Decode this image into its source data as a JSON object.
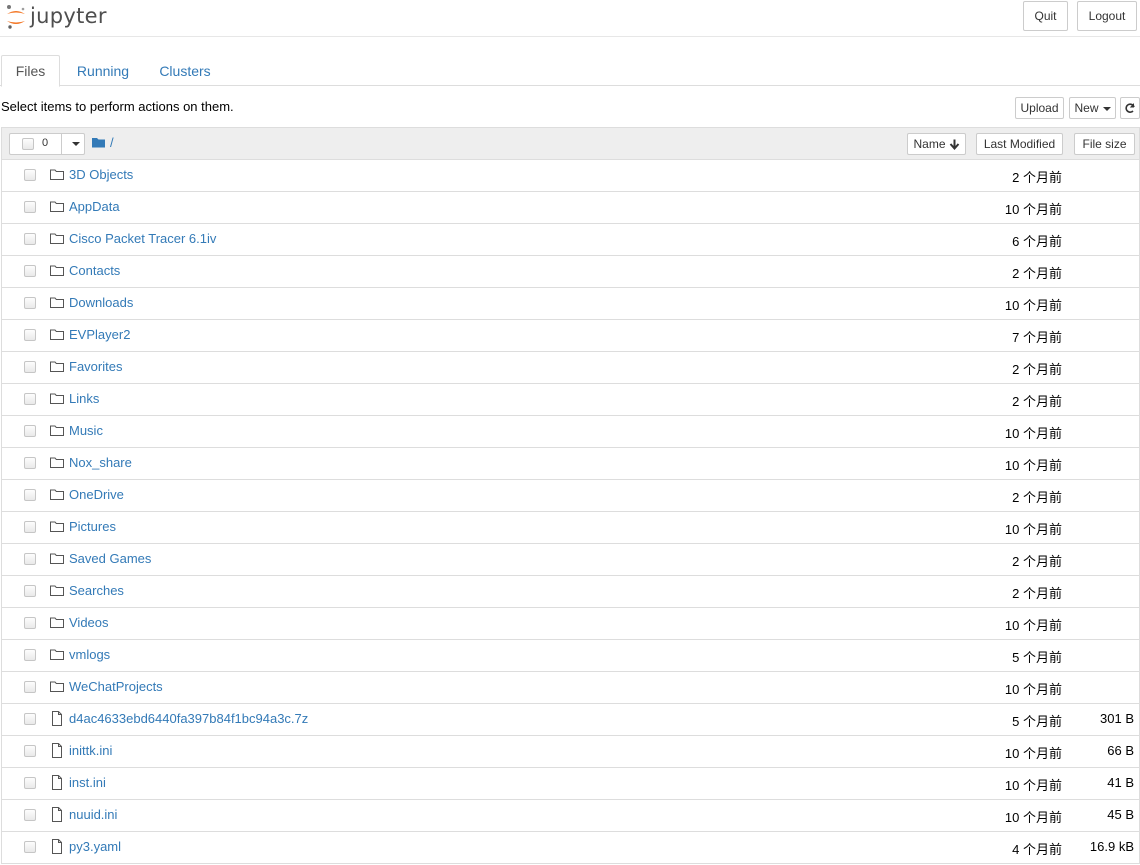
{
  "app": {
    "logo_text": "jupyter",
    "quit_label": "Quit",
    "logout_label": "Logout"
  },
  "tabs": [
    {
      "label": "Files",
      "active": true
    },
    {
      "label": "Running",
      "active": false
    },
    {
      "label": "Clusters",
      "active": false
    }
  ],
  "toolbar": {
    "hint": "Select items to perform actions on them.",
    "upload_label": "Upload",
    "new_label": "New",
    "refresh_icon": "refresh-icon"
  },
  "list_header": {
    "selected_count": "0",
    "breadcrumb_path": "/",
    "sort_name_label": "Name",
    "sort_modified_label": "Last Modified",
    "sort_size_label": "File size"
  },
  "colors": {
    "link": "#337ab7",
    "logo_orange": "#f37726",
    "header_bg": "#eeeeee"
  },
  "files": [
    {
      "type": "folder",
      "name": "3D Objects",
      "modified": "2 个月前",
      "size": ""
    },
    {
      "type": "folder",
      "name": "AppData",
      "modified": "10 个月前",
      "size": ""
    },
    {
      "type": "folder",
      "name": "Cisco Packet Tracer 6.1iv",
      "modified": "6 个月前",
      "size": ""
    },
    {
      "type": "folder",
      "name": "Contacts",
      "modified": "2 个月前",
      "size": ""
    },
    {
      "type": "folder",
      "name": "Downloads",
      "modified": "10 个月前",
      "size": ""
    },
    {
      "type": "folder",
      "name": "EVPlayer2",
      "modified": "7 个月前",
      "size": ""
    },
    {
      "type": "folder",
      "name": "Favorites",
      "modified": "2 个月前",
      "size": ""
    },
    {
      "type": "folder",
      "name": "Links",
      "modified": "2 个月前",
      "size": ""
    },
    {
      "type": "folder",
      "name": "Music",
      "modified": "10 个月前",
      "size": ""
    },
    {
      "type": "folder",
      "name": "Nox_share",
      "modified": "10 个月前",
      "size": ""
    },
    {
      "type": "folder",
      "name": "OneDrive",
      "modified": "2 个月前",
      "size": ""
    },
    {
      "type": "folder",
      "name": "Pictures",
      "modified": "10 个月前",
      "size": ""
    },
    {
      "type": "folder",
      "name": "Saved Games",
      "modified": "2 个月前",
      "size": ""
    },
    {
      "type": "folder",
      "name": "Searches",
      "modified": "2 个月前",
      "size": ""
    },
    {
      "type": "folder",
      "name": "Videos",
      "modified": "10 个月前",
      "size": ""
    },
    {
      "type": "folder",
      "name": "vmlogs",
      "modified": "5 个月前",
      "size": ""
    },
    {
      "type": "folder",
      "name": "WeChatProjects",
      "modified": "10 个月前",
      "size": ""
    },
    {
      "type": "file",
      "name": "d4ac4633ebd6440fa397b84f1bc94a3c.7z",
      "modified": "5 个月前",
      "size": "301 B"
    },
    {
      "type": "file",
      "name": "inittk.ini",
      "modified": "10 个月前",
      "size": "66 B"
    },
    {
      "type": "file",
      "name": "inst.ini",
      "modified": "10 个月前",
      "size": "41 B"
    },
    {
      "type": "file",
      "name": "nuuid.ini",
      "modified": "10 个月前",
      "size": "45 B"
    },
    {
      "type": "file",
      "name": "py3.yaml",
      "modified": "4 个月前",
      "size": "16.9 kB"
    }
  ]
}
